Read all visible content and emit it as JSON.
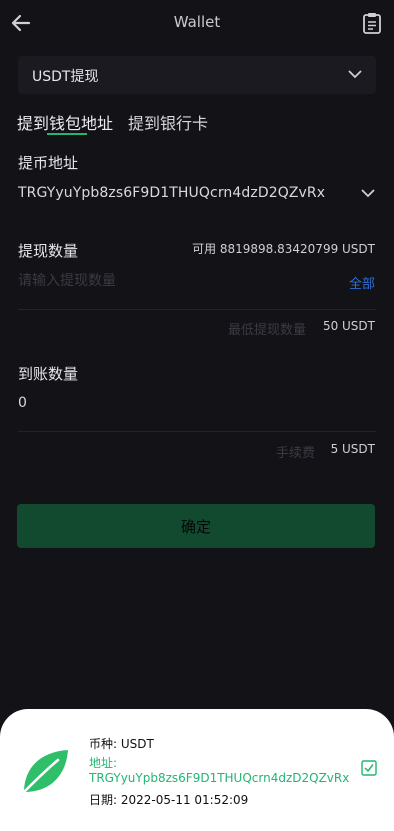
{
  "header": {
    "title": "Wallet"
  },
  "currency_select": {
    "value": "USDT提现"
  },
  "tabs": [
    {
      "label": "提到钱包地址"
    },
    {
      "label": "提到银行卡"
    }
  ],
  "address": {
    "label": "提币地址",
    "value": "TRGYyuYpb8zs6F9D1THUQcrn4dzD2QZvRx"
  },
  "amount": {
    "label": "提现数量",
    "available": "可用 8819898.83420799 USDT",
    "placeholder": "请输入提现数量",
    "all_label": "全部",
    "min_label": "最低提现数量",
    "min_value": "50 USDT"
  },
  "received": {
    "label": "到账数量",
    "value": "0",
    "fee_label": "手续费",
    "fee_value": "5 USDT"
  },
  "confirm_label": "确定",
  "toast": {
    "coin": "币种: USDT",
    "address_label": "地址:",
    "address_value": "TRGYyuYpb8zs6F9D1THUQcrn4dzD2QZvRx",
    "date": "日期: 2022-05-11 01:52:09"
  },
  "colors": {
    "accent": "#22b573",
    "background": "#131217",
    "link": "#2d6fd6"
  }
}
